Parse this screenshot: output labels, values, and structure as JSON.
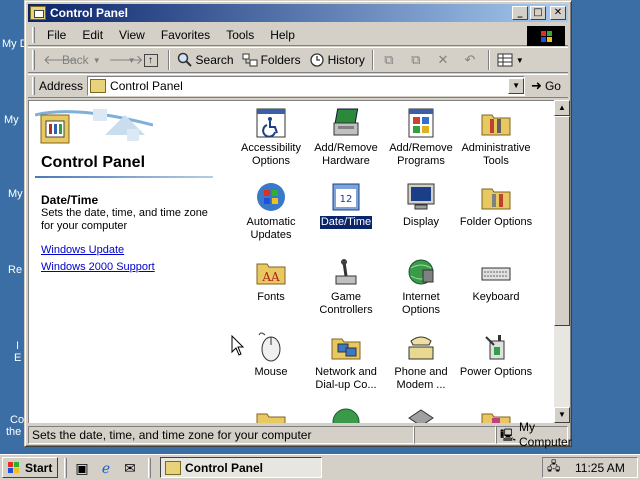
{
  "desktop": {
    "fragments": [
      "My D",
      "My",
      "My",
      "Re",
      "I",
      "E",
      "Co",
      "the"
    ]
  },
  "window": {
    "title": "Control Panel",
    "controls": {
      "minimize": "_",
      "maximize": "□",
      "close": "✕"
    }
  },
  "menubar": {
    "items": [
      "File",
      "Edit",
      "View",
      "Favorites",
      "Tools",
      "Help"
    ]
  },
  "toolbar": {
    "back": "Back",
    "search": "Search",
    "folders": "Folders",
    "history": "History"
  },
  "addressbar": {
    "label": "Address",
    "value": "Control Panel",
    "go": "Go"
  },
  "left_pane": {
    "title": "Control Panel",
    "selected_name": "Date/Time",
    "selected_desc": "Sets the date, time, and time zone for your computer",
    "links": [
      "Windows Update",
      "Windows 2000 Support"
    ]
  },
  "items": [
    {
      "label": "Accessibility Options",
      "icon": "accessibility-icon"
    },
    {
      "label": "Add/Remove Hardware",
      "icon": "hardware-icon"
    },
    {
      "label": "Add/Remove Programs",
      "icon": "programs-icon"
    },
    {
      "label": "Administrative Tools",
      "icon": "admin-tools-icon"
    },
    {
      "label": "Automatic Updates",
      "icon": "updates-icon"
    },
    {
      "label": "Date/Time",
      "icon": "calendar-icon",
      "selected": true
    },
    {
      "label": "Display",
      "icon": "display-icon"
    },
    {
      "label": "Folder Options",
      "icon": "folder-options-icon"
    },
    {
      "label": "Fonts",
      "icon": "fonts-icon"
    },
    {
      "label": "Game Controllers",
      "icon": "joystick-icon"
    },
    {
      "label": "Internet Options",
      "icon": "internet-icon"
    },
    {
      "label": "Keyboard",
      "icon": "keyboard-icon"
    },
    {
      "label": "Mouse",
      "icon": "mouse-icon"
    },
    {
      "label": "Network and Dial-up Co...",
      "icon": "network-icon"
    },
    {
      "label": "Phone and Modem ...",
      "icon": "phone-icon"
    },
    {
      "label": "Power Options",
      "icon": "power-icon"
    }
  ],
  "statusbar": {
    "text": "Sets the date, time, and time zone for your computer",
    "zone": "My Computer"
  },
  "taskbar": {
    "start": "Start",
    "task": "Control Panel",
    "clock": "11:25 AM"
  },
  "colors": {
    "desktop": "#3a6ea5",
    "title_start": "#0a246a",
    "title_end": "#a6caf0",
    "face": "#d4d0c8",
    "link": "#0000cc"
  }
}
